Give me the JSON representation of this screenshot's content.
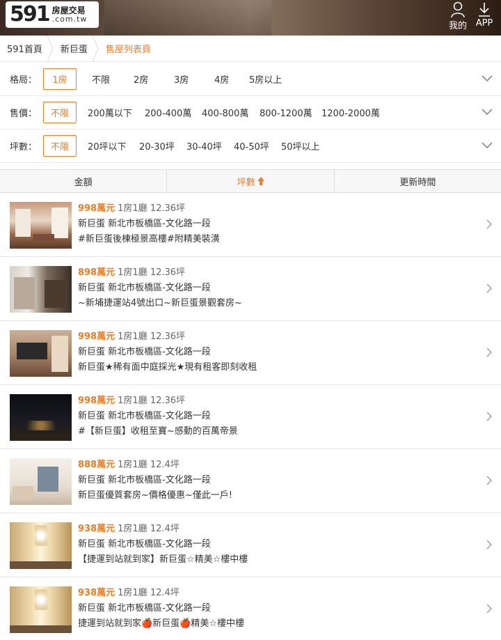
{
  "header": {
    "logo_num": "591",
    "logo_cn": "房屋交易",
    "logo_domain": ".com.tw",
    "me_label": "我的",
    "app_label": "APP"
  },
  "breadcrumb": [
    "591首頁",
    "新巨蛋",
    "售屋列表頁"
  ],
  "filters": [
    {
      "label": "格局：",
      "options": [
        "1房",
        "不限",
        "2房",
        "3房",
        "4房",
        "5房以上"
      ],
      "selected": "1房"
    },
    {
      "label": "售價：",
      "options": [
        "不限",
        "200萬以下",
        "200-400萬",
        "400-800萬",
        "800-1200萬",
        "1200-2000萬"
      ],
      "selected": "不限"
    },
    {
      "label": "坪數：",
      "options": [
        "不限",
        "20坪以下",
        "20-30坪",
        "30-40坪",
        "40-50坪",
        "50坪以上"
      ],
      "selected": "不限"
    }
  ],
  "sort": {
    "tabs": [
      "金額",
      "坪數",
      "更新時間"
    ],
    "active": "坪數"
  },
  "listings": [
    {
      "price": "998萬元",
      "layout": "1房1廳 12.36坪",
      "address": "新巨蛋 新北市板橋區-文化路一段",
      "title": "#新巨蛋後棟極景高樓#附精美裝潢"
    },
    {
      "price": "898萬元",
      "layout": "1房1廳 12.36坪",
      "address": "新巨蛋 新北市板橋區-文化路一段",
      "title": "~新埔捷運站4號出口~新巨蛋景觀套房~"
    },
    {
      "price": "998萬元",
      "layout": "1房1廳 12.36坪",
      "address": "新巨蛋 新北市板橋區-文化路一段",
      "title": "新巨蛋★稀有面中庭採光★現有租客即刻收租"
    },
    {
      "price": "998萬元",
      "layout": "1房1廳 12.36坪",
      "address": "新巨蛋 新北市板橋區-文化路一段",
      "title": "#【新巨蛋】收租至寶~感動的百萬帝景"
    },
    {
      "price": "888萬元",
      "layout": "1房1廳 12.4坪",
      "address": "新巨蛋 新北市板橋區-文化路一段",
      "title": "新巨蛋優質套房~價格優惠~僅此一戶!"
    },
    {
      "price": "938萬元",
      "layout": "1房1廳 12.4坪",
      "address": "新巨蛋 新北市板橋區-文化路一段",
      "title": "【捷運到站就到家】新巨蛋☆精美☆樓中樓"
    },
    {
      "price": "938萬元",
      "layout": "1房1廳 12.4坪",
      "address": "新巨蛋 新北市板橋區-文化路一段",
      "title": "捷運到站就到家🍎新巨蛋🍎精美☆樓中樓"
    }
  ],
  "colors": {
    "accent": "#f47b20"
  }
}
